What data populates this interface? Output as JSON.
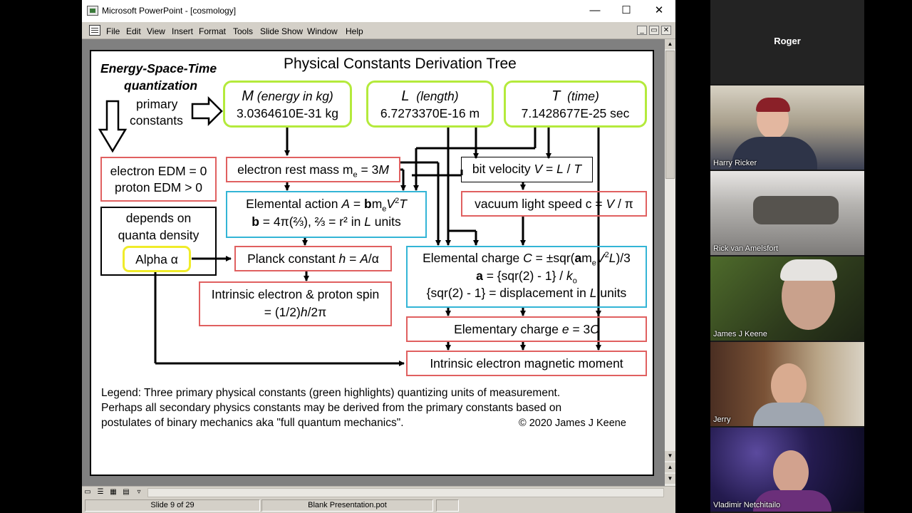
{
  "window": {
    "title": "Microsoft PowerPoint - [cosmology]",
    "minimize_glyph": "—",
    "maximize_glyph": "☐",
    "close_glyph": "✕"
  },
  "menu": [
    "File",
    "Edit",
    "View",
    "Insert",
    "Format",
    "Tools",
    "Slide Show",
    "Window",
    "Help"
  ],
  "mdi_controls": [
    "_",
    "▭",
    "✕"
  ],
  "slide": {
    "title": "Physical Constants Derivation Tree",
    "left_heading": [
      "Energy-Space-Time",
      "quantization"
    ],
    "primary_label": [
      "primary",
      "constants"
    ],
    "primaries": [
      {
        "symbol": "M",
        "desc": "(energy in kg)",
        "value": "3.0364610E-31 kg"
      },
      {
        "symbol": "L",
        "desc": "(length)",
        "value": "6.7273370E-16 m"
      },
      {
        "symbol": "T",
        "desc": "(time)",
        "value": "7.1428677E-25 sec"
      }
    ],
    "edm": [
      "electron EDM = 0",
      "proton EDM > 0"
    ],
    "depends": [
      "depends on",
      "quanta density"
    ],
    "alpha": "Alpha α",
    "rest_mass": {
      "text": "electron rest mass m",
      "sub": "e",
      "rest": " = 3",
      "var": "M"
    },
    "bit_velocity": {
      "text": "bit velocity ",
      "var": "V",
      "rest": " = ",
      "l": "L",
      "slash": " / ",
      "t": "T"
    },
    "light_speed": {
      "text": "vacuum light speed c = ",
      "var": "V",
      "rest": " / π"
    },
    "action": {
      "line1_a": "Elemental action ",
      "line1_A": "A",
      "line1_b": " = ",
      "line1_bold": "b",
      "line1_m": "m",
      "line1_sub": "e",
      "line1_V": "V",
      "line1_sup": "2",
      "line1_T": "T",
      "line2_bold": "b",
      "line2_rest": " = 4π(⅔), ⅔ = r² in ",
      "line2_L": "L",
      "line2_end": " units"
    },
    "planck": {
      "text": "Planck constant ",
      "h": "h",
      "rest": " = ",
      "A": "A",
      "end": "/α"
    },
    "spin": {
      "line1": "Intrinsic electron & proton spin",
      "line2_a": "= (1/2)",
      "line2_h": "h",
      "line2_b": "/2π"
    },
    "charge": {
      "l1_a": "Elemental charge ",
      "l1_C": "C",
      "l1_b": " = ±sqr(",
      "l1_bold": "a",
      "l1_m": "m",
      "l1_sub": "e",
      "l1_V": "V",
      "l1_sup": "2",
      "l1_L": "L",
      "l1_end": ")/3",
      "l2_bold": "a",
      "l2_rest": " = {sqr(2) - 1} / ",
      "l2_k": "k",
      "l2_sub": "o",
      "l3_a": "{sqr(2) - 1} = displacement in ",
      "l3_L": "L",
      "l3_end": " units"
    },
    "elementary": {
      "text": "Elementary charge ",
      "e": "e",
      "rest": " = 3",
      "C": "C"
    },
    "moment": "Intrinsic electron magnetic moment",
    "legend": [
      "Legend: Three primary physical constants (green highlights) quantizing units of measurement.",
      "Perhaps all secondary physics constants may be derived from the primary constants based on",
      "postulates of binary mechanics aka \"full quantum mechanics\"."
    ],
    "copyright": "© 2020 James J Keene"
  },
  "status": {
    "slide_indicator": "Slide 9 of 29",
    "template": "Blank Presentation.pot"
  },
  "participants": {
    "host": "Roger",
    "videos": [
      "Harry Ricker",
      "Rick van Amelsfort",
      "James J Keene",
      "Jerry",
      "Vladimir Netchitailo"
    ]
  }
}
